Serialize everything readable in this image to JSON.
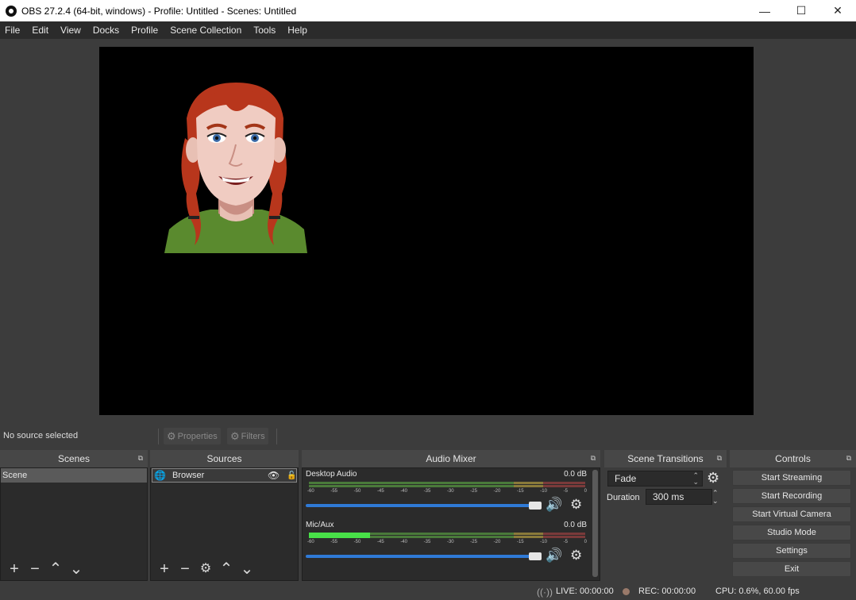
{
  "window": {
    "title": "OBS 27.2.4 (64-bit, windows) - Profile: Untitled - Scenes: Untitled",
    "minimize": "—",
    "maximize": "☐",
    "close": "✕"
  },
  "menu": [
    "File",
    "Edit",
    "View",
    "Docks",
    "Profile",
    "Scene Collection",
    "Tools",
    "Help"
  ],
  "source_toolbar": {
    "status": "No source selected",
    "properties": "Properties",
    "filters": "Filters"
  },
  "scenes": {
    "title": "Scenes",
    "items": [
      "Scene"
    ],
    "footer": [
      "+",
      "−",
      "⌃",
      "⌄"
    ]
  },
  "sources": {
    "title": "Sources",
    "items": [
      {
        "name": "Browser",
        "icon": "globe-icon"
      }
    ]
  },
  "audio_mixer": {
    "title": "Audio Mixer",
    "channels": [
      {
        "name": "Desktop Audio",
        "db": "0.0 dB",
        "level": 0.0,
        "volume": 1.0
      },
      {
        "name": "Mic/Aux",
        "db": "0.0 dB",
        "level": 0.22,
        "volume": 1.0
      }
    ],
    "ticks": [
      "-60",
      "-55",
      "-50",
      "-45",
      "-40",
      "-35",
      "-30",
      "-25",
      "-20",
      "-15",
      "-10",
      "-5",
      "0"
    ]
  },
  "scene_transitions": {
    "title": "Scene Transitions",
    "transition": "Fade",
    "duration_label": "Duration",
    "duration": "300 ms"
  },
  "controls": {
    "title": "Controls",
    "buttons": [
      "Start Streaming",
      "Start Recording",
      "Start Virtual Camera",
      "Studio Mode",
      "Settings",
      "Exit"
    ]
  },
  "status_bar": {
    "live": "LIVE: 00:00:00",
    "rec": "REC: 00:00:00",
    "cpu": "CPU: 0.6%, 60.00 fps"
  },
  "colors": {
    "accent": "#2f7ad6",
    "meter_green": "#48e048",
    "background": "#3c3c3c"
  }
}
